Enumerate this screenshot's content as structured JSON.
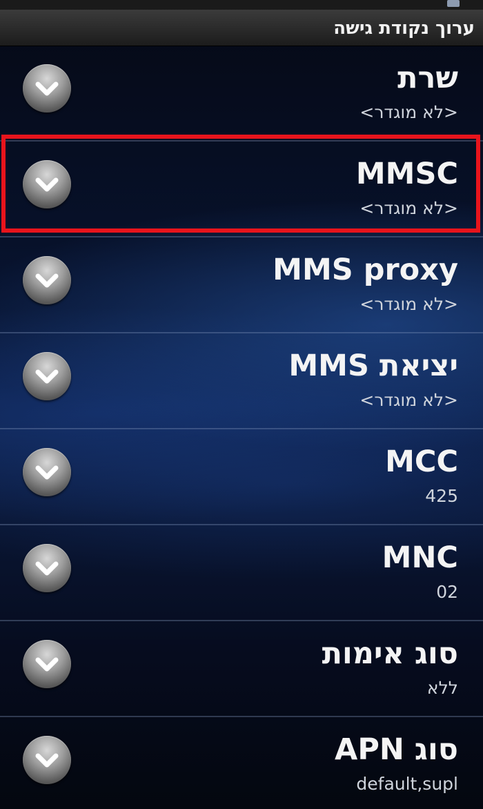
{
  "header": {
    "title": "ערוך נקודת גישה"
  },
  "fields": [
    {
      "id": "server",
      "label": "שרת",
      "value": "<לא מוגדר>"
    },
    {
      "id": "mmsc",
      "label": "MMSC",
      "value": "<לא מוגדר>"
    },
    {
      "id": "mms-proxy",
      "label": "MMS proxy",
      "value": "<לא מוגדר>"
    },
    {
      "id": "mms-port",
      "label": "יציאת MMS",
      "value": "<לא מוגדר>"
    },
    {
      "id": "mcc",
      "label": "MCC",
      "value": "425"
    },
    {
      "id": "mnc",
      "label": "MNC",
      "value": "02"
    },
    {
      "id": "auth-type",
      "label": "סוג אימות",
      "value": "ללא"
    },
    {
      "id": "apn-type",
      "label": "סוג APN",
      "value": "default,supl"
    }
  ],
  "highlight": {
    "field": "mmsc",
    "color": "#e8141c"
  },
  "icons": {
    "row_button": "chevron-down-icon"
  }
}
